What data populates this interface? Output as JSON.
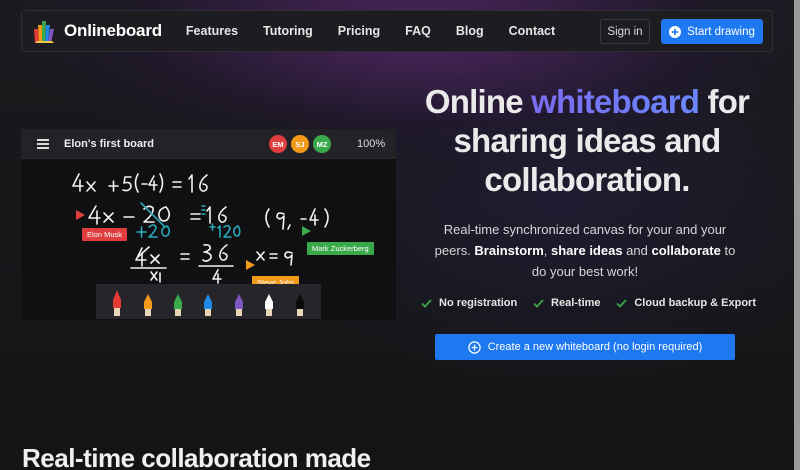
{
  "brand": {
    "name": "Onlineboard"
  },
  "nav": {
    "links": [
      "Features",
      "Tutoring",
      "Pricing",
      "FAQ",
      "Blog",
      "Contact"
    ],
    "signin_label": "Sign in",
    "start_label": "Start drawing"
  },
  "board": {
    "title": "Elon's first board",
    "zoom": "100%",
    "users": [
      {
        "initials": "EM",
        "color": "#e03e3e"
      },
      {
        "initials": "SJ",
        "color": "#f39a1b"
      },
      {
        "initials": "MZ",
        "color": "#3aa94a"
      }
    ],
    "cursors": [
      {
        "name": "Elon Musk",
        "color": "#e03e3e"
      },
      {
        "name": "Mark Zuckerberg",
        "color": "#3aa94a"
      },
      {
        "name": "Steve Jobs",
        "color": "#f39a1b"
      }
    ],
    "pencils": [
      "#e53935",
      "#f39a1b",
      "#3aa94a",
      "#1e88e5",
      "#7e57c2",
      "#ffffff",
      "#111111"
    ]
  },
  "hero": {
    "title_pre": "Online ",
    "title_accent": "whiteboard",
    "title_post": " for sharing ideas and collaboration.",
    "desc_1": "Real-time synchronized canvas for your and your peers. ",
    "desc_b1": "Brainstorm",
    "desc_2": ", ",
    "desc_b2": "share ideas",
    "desc_3": " and ",
    "desc_b3": "collaborate",
    "desc_4": " to do your best work!",
    "features": [
      "No registration",
      "Real-time",
      "Cloud backup & Export"
    ],
    "cta_label": "Create a new whiteboard (no login required)"
  },
  "section": {
    "title": "Real-time collaboration made"
  },
  "colors": {
    "accent": "#1e78f0",
    "background": "#141416"
  }
}
